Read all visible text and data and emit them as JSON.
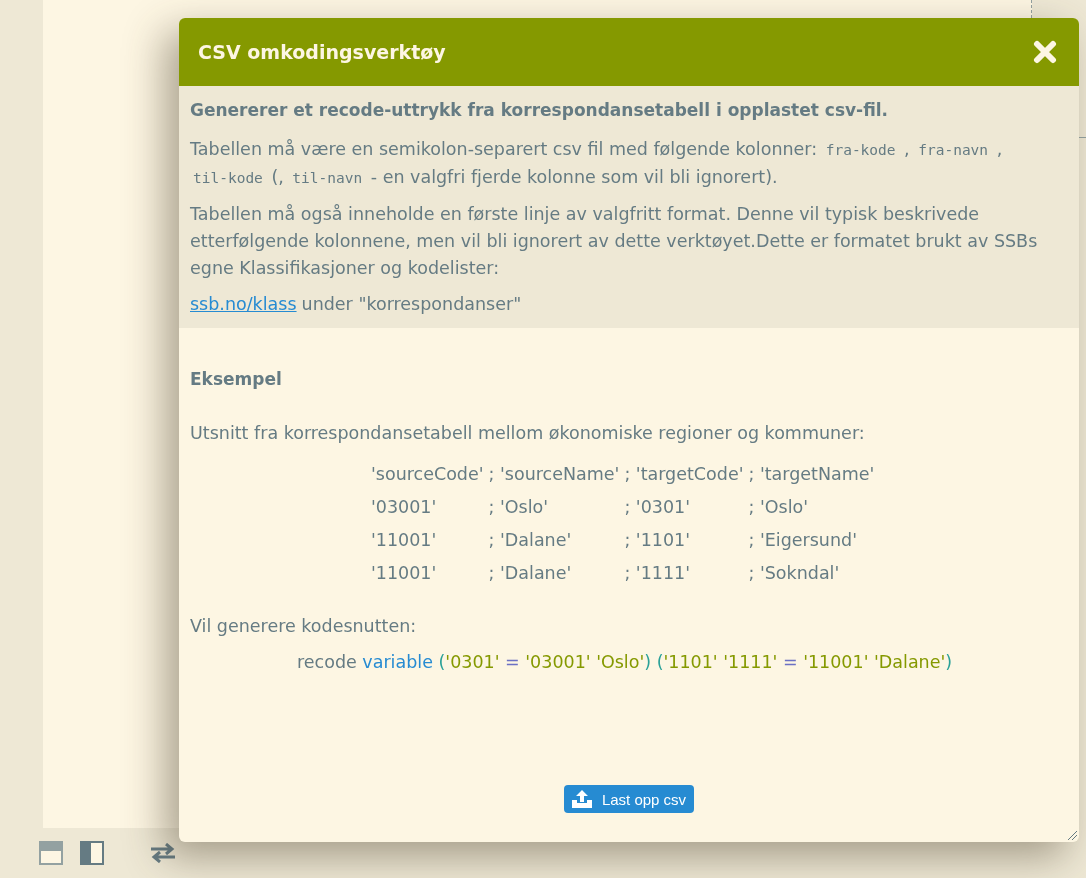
{
  "dialog": {
    "title": "CSV omkodingsverktøy"
  },
  "intro": {
    "heading": "Genererer et recode-uttrykk fra korrespondansetabell i opplastet csv-fil.",
    "paragraphs": [
      [
        {
          "kind": "text",
          "text": "Tabellen må være en semikolon-separert csv fil med følgende kolonner: "
        },
        {
          "kind": "code",
          "text": "fra-kode"
        },
        {
          "kind": "text",
          "text": " , "
        },
        {
          "kind": "code",
          "text": "fra-navn"
        },
        {
          "kind": "text",
          "text": " , "
        },
        {
          "kind": "code",
          "text": "til-kode"
        },
        {
          "kind": "text",
          "text": " (, "
        },
        {
          "kind": "code",
          "text": "til-navn"
        },
        {
          "kind": "text",
          "text": " - en valgfri fjerde kolonne som vil bli ignorert)."
        }
      ],
      [
        {
          "kind": "text",
          "text": "Tabellen må også inneholde en første linje av valgfritt format. Denne vil typisk beskrivede etterfølgende kolonnene, men vil bli ignorert av dette verktøyet.Dette er formatet brukt av SSBs egne Klassifikasjoner og kodelister:"
        }
      ]
    ],
    "link": {
      "text": "ssb.no/klass",
      "after": "under \"korrespondanser\""
    }
  },
  "example": {
    "heading": "Eksempel",
    "caption": "Utsnitt fra korrespondansetabell mellom økonomiske regioner og kommuner:",
    "rows": [
      [
        "'sourceCode'",
        "; 'sourceName'",
        "; 'targetCode'",
        "; 'targetName'"
      ],
      [
        "'03001'",
        "; 'Oslo'",
        "; '0301'",
        "; 'Oslo'"
      ],
      [
        "'11001'",
        "; 'Dalane'",
        "; '1101'",
        "; 'Eigersund'"
      ],
      [
        "'11001'",
        "; 'Dalane'",
        "; '1111'",
        "; 'Sokndal'"
      ]
    ],
    "result_label": "Vil generere kodesnutten:",
    "code": [
      {
        "kind": "plain",
        "text": "recode "
      },
      {
        "kind": "identifier",
        "text": "variable "
      },
      {
        "kind": "paren",
        "text": "("
      },
      {
        "kind": "string",
        "text": "'0301' "
      },
      {
        "kind": "operator",
        "text": "= "
      },
      {
        "kind": "string",
        "text": "'03001' 'Oslo'"
      },
      {
        "kind": "paren",
        "text": ") ("
      },
      {
        "kind": "string",
        "text": "'1101' '1111' "
      },
      {
        "kind": "operator",
        "text": "= "
      },
      {
        "kind": "string",
        "text": "'11001' 'Dalane'"
      },
      {
        "kind": "paren",
        "text": ")"
      }
    ]
  },
  "upload_button": {
    "label": "Last opp csv"
  },
  "toolbar": [
    {
      "kind": "layout-top",
      "selected": false
    },
    {
      "kind": "layout-side",
      "selected": true
    },
    {
      "kind": "swap"
    }
  ]
}
